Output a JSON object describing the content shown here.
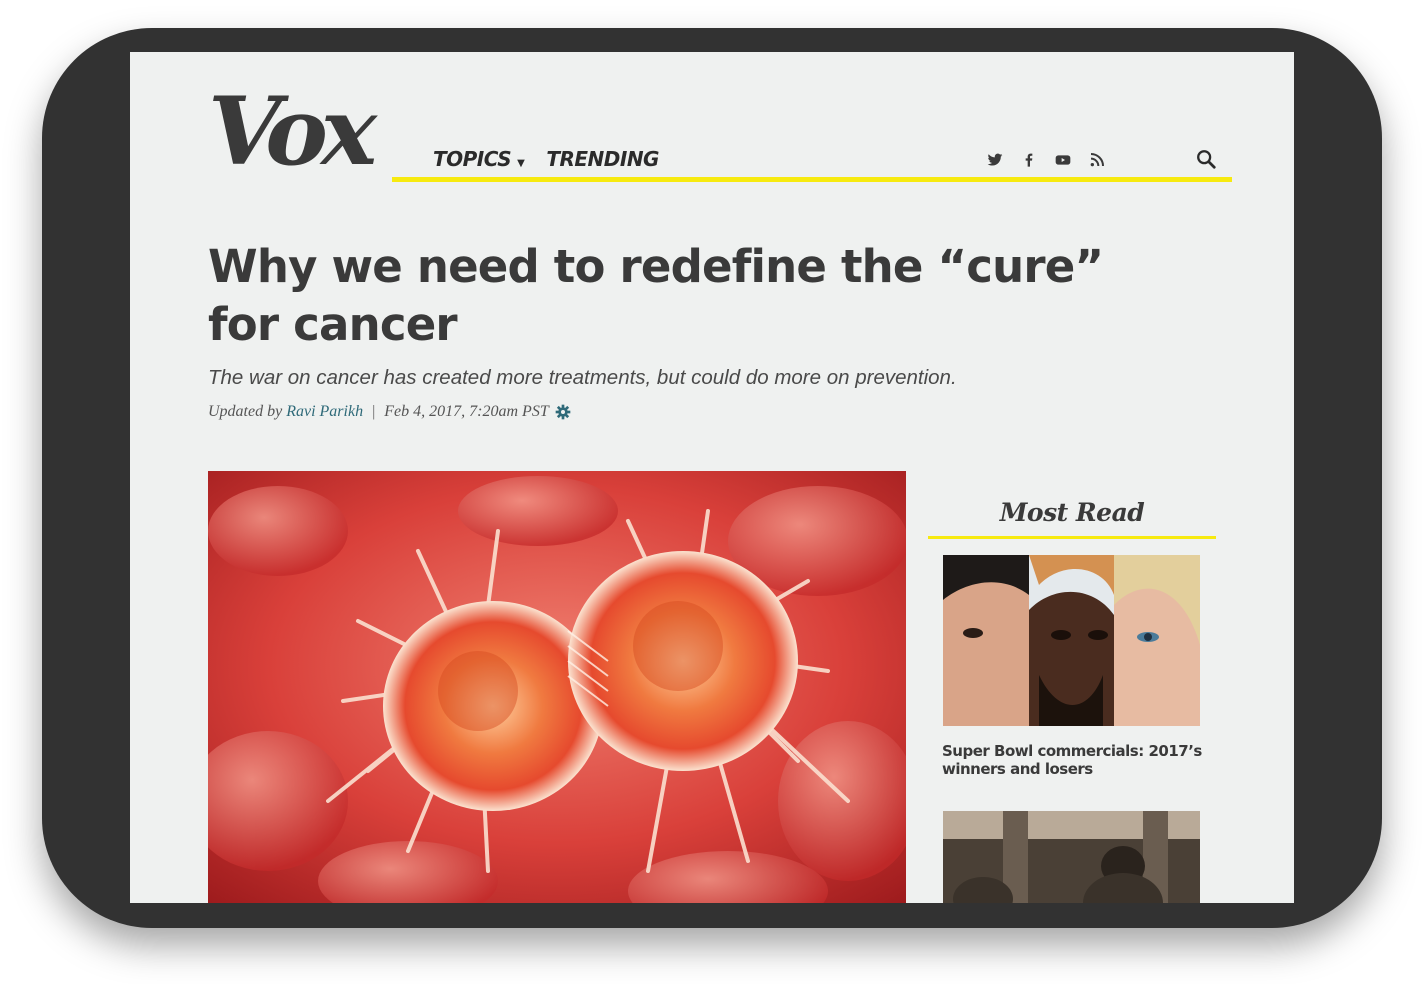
{
  "site": {
    "logo": "Vox"
  },
  "nav": {
    "topics": "TOPICS",
    "trending": "TRENDING"
  },
  "social_icons": [
    "twitter-icon",
    "facebook-icon",
    "youtube-icon",
    "rss-icon"
  ],
  "article": {
    "headline": "Why we need to redefine the “cure” for cancer",
    "dek": "The war on cancer has created more treatments, but could do more on prevention.",
    "updated_prefix": "Updated by",
    "author": "Ravi Parikh",
    "separator": "|",
    "timestamp": "Feb 4, 2017, 7:20am PST"
  },
  "sidebar": {
    "title": "Most Read",
    "stories": [
      {
        "title": "Super Bowl commercials: 2017’s winners and losers"
      }
    ]
  },
  "colors": {
    "accent_yellow": "#f7ea0f",
    "text_dark": "#3a3a3a",
    "author_link": "#2f6a79",
    "device_frame": "#323232",
    "page_bg": "#eff1f0"
  }
}
